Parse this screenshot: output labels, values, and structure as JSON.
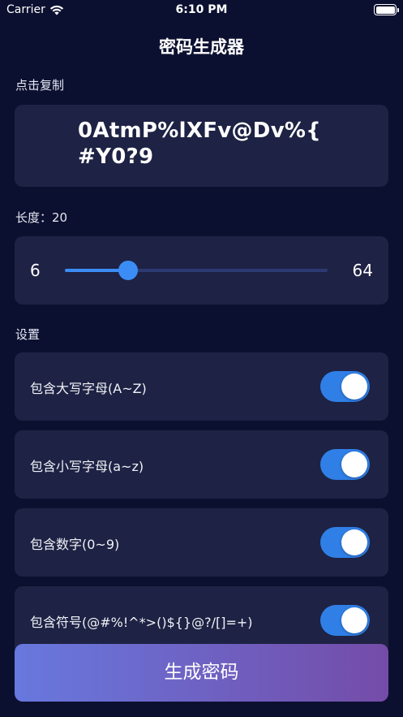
{
  "status_bar": {
    "carrier": "Carrier",
    "time": "6:10 PM"
  },
  "header": {
    "title": "密码生成器"
  },
  "password_section": {
    "label": "点击复制",
    "password_line1": "0AtmP%lXFv@Dv%{",
    "password_line2": "#Y0?9"
  },
  "length_section": {
    "label": "长度：20",
    "min": "6",
    "max": "64",
    "value": 20
  },
  "settings_section": {
    "label": "设置",
    "options": [
      {
        "label": "包含大写字母(A~Z)",
        "enabled": true
      },
      {
        "label": "包含小写字母(a~z)",
        "enabled": true
      },
      {
        "label": "包含数字(0~9)",
        "enabled": true
      },
      {
        "label": "包含符号(@#%!^*>()${}@?/[]=+)",
        "enabled": true
      }
    ]
  },
  "actions": {
    "generate_label": "生成密码"
  },
  "colors": {
    "background": "#0c1030",
    "card": "#1e2244",
    "accent": "#3b8df5",
    "toggle_on": "#2f7fe6",
    "button_gradient_start": "#6878de",
    "button_gradient_end": "#744ca8"
  },
  "icons": {
    "signal": "wifi-icon",
    "battery": "battery-icon"
  }
}
